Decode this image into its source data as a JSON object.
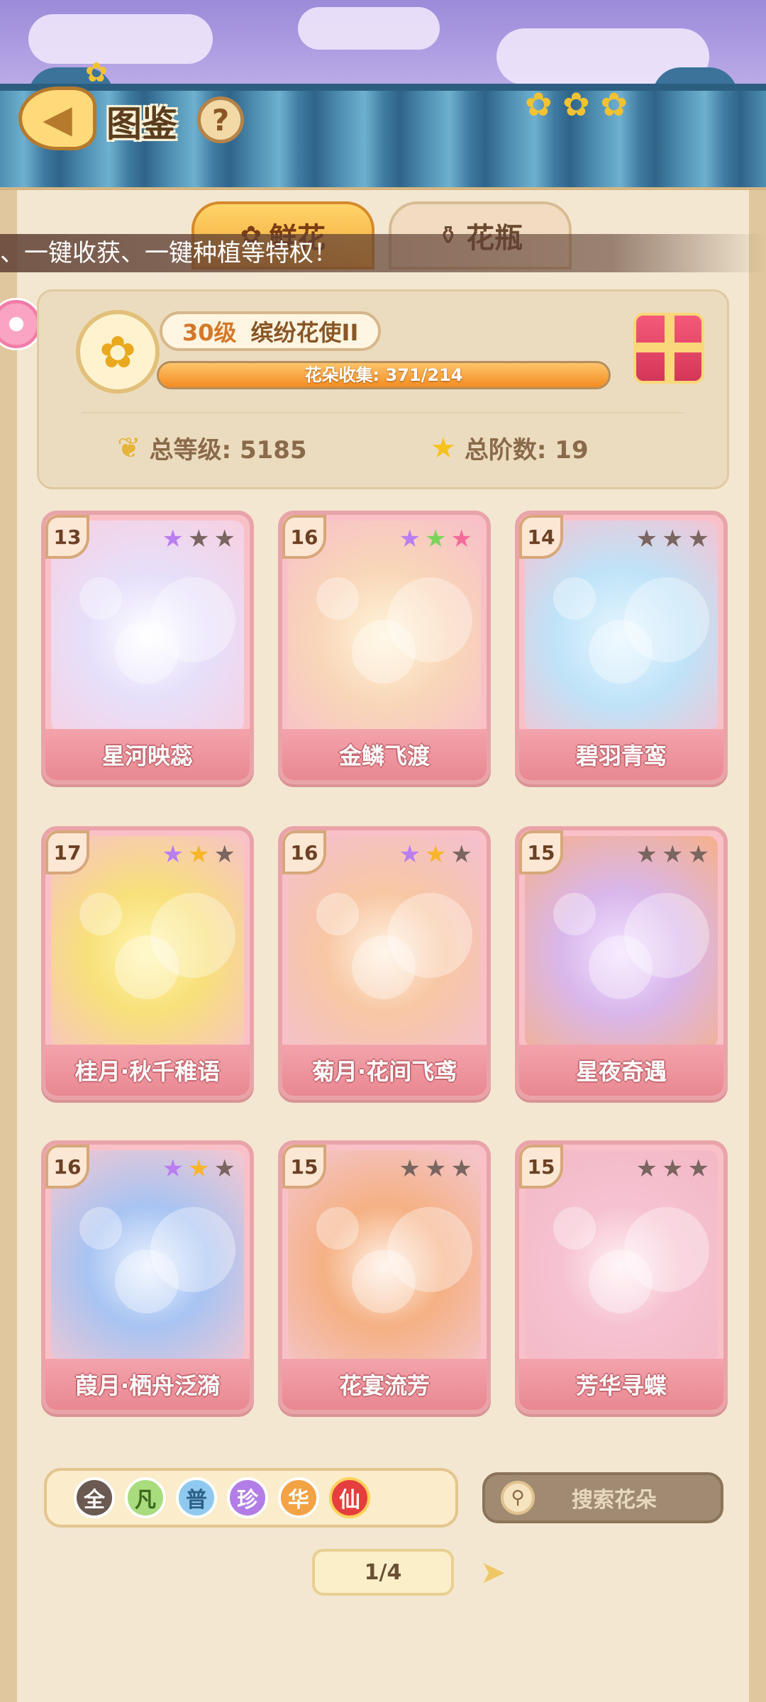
{
  "header": {
    "title": "图鉴",
    "help_label": "?",
    "back_label": "◀"
  },
  "tabs": [
    {
      "label": "鲜花",
      "icon": "flower-icon",
      "active": true
    },
    {
      "label": "花瓶",
      "icon": "vase-icon",
      "active": false
    }
  ],
  "marquee": {
    "text": "、一键收获、一键种植等特权！"
  },
  "summary": {
    "level_label": "30级",
    "rank_label": "缤纷花使II",
    "progress_text": "花朵收集: 371/214",
    "progress_fraction": 1.0,
    "total_level_text": "总等级: 5185",
    "total_stage_text": "总阶数: 19"
  },
  "cards": [
    {
      "level": "13",
      "name": "星河映蕊",
      "stars": [
        "purple",
        "gray",
        "gray"
      ]
    },
    {
      "level": "16",
      "name": "金鳞飞渡",
      "stars": [
        "purple",
        "green",
        "pink"
      ]
    },
    {
      "level": "14",
      "name": "碧羽青鸾",
      "stars": [
        "gray",
        "gray",
        "gray"
      ]
    },
    {
      "level": "17",
      "name": "桂月·秋千稚语",
      "stars": [
        "purple",
        "gold",
        "gray"
      ]
    },
    {
      "level": "16",
      "name": "菊月·花间飞鸢",
      "stars": [
        "purple",
        "gold",
        "gray"
      ]
    },
    {
      "level": "15",
      "name": "星夜奇遇",
      "stars": [
        "gray",
        "gray",
        "gray"
      ]
    },
    {
      "level": "16",
      "name": "葭月·栖舟泛漪",
      "stars": [
        "purple",
        "gold",
        "gray"
      ]
    },
    {
      "level": "15",
      "name": "花宴流芳",
      "stars": [
        "gray",
        "gray",
        "gray"
      ]
    },
    {
      "level": "15",
      "name": "芳华寻蝶",
      "stars": [
        "gray",
        "gray",
        "gray"
      ]
    }
  ],
  "filters": [
    {
      "label": "全",
      "key": "all"
    },
    {
      "label": "凡",
      "key": "common"
    },
    {
      "label": "普",
      "key": "normal"
    },
    {
      "label": "珍",
      "key": "rare"
    },
    {
      "label": "华",
      "key": "fine"
    },
    {
      "label": "仙",
      "key": "immortal"
    }
  ],
  "search": {
    "placeholder": "搜索花朵"
  },
  "pager": {
    "text": "1/4"
  },
  "colors": {
    "roof_blue": "#4f8fb2",
    "card_pink": "#f9c1c7",
    "accent_orange": "#f28c22",
    "star_gold": "#f7b52a"
  }
}
